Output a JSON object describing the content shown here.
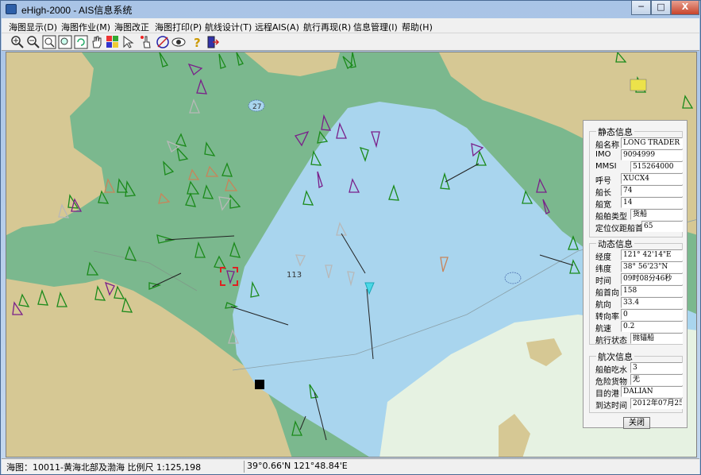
{
  "window": {
    "title": "eHigh-2000 - AIS信息系统",
    "buttons": {
      "minimize": "─",
      "maximize": "□",
      "close": "X"
    }
  },
  "menu": [
    "海图显示(D)",
    "海图作业(M)",
    "海图改正",
    "海图打印(P)",
    "航线设计(T)",
    "远程AIS(A)",
    "航行再现(R)",
    "信息管理(I)",
    "帮助(H)"
  ],
  "toolbar": {
    "tools": [
      "zoom-in-icon",
      "zoom-out-icon",
      "zoom-box-icon",
      "zoom-fit-icon",
      "refresh-icon",
      "pan-hand-icon",
      "layers-icon",
      "select-arrow-icon",
      "pick-hand-icon",
      "circle-tool-icon",
      "eye-icon",
      "help-icon",
      "exit-icon"
    ]
  },
  "map": {
    "colors": {
      "land": "#d6c894",
      "shallow": "#7bb88e",
      "water": "#a9d5ee",
      "deep": "#e6f2e2"
    },
    "labels": {
      "depth1": "27",
      "depth2": "113"
    }
  },
  "panel": {
    "static": {
      "title": "静态信息",
      "rows": [
        {
          "label": "船名称",
          "value": "LONG TRADER"
        },
        {
          "label": "IMO",
          "value": "9094999"
        },
        {
          "label": "MMSI",
          "value": "515264000"
        },
        {
          "label": "呼号",
          "value": "XUCX4"
        },
        {
          "label": "船长",
          "value": "74"
        },
        {
          "label": "船宽",
          "value": "14"
        },
        {
          "label": "船舶类型",
          "value": "货船"
        },
        {
          "label": "定位仪距船首",
          "value": "65"
        }
      ]
    },
    "dynamic": {
      "title": "动态信息",
      "rows": [
        {
          "label": "经度",
          "value": "121° 42'14\"E"
        },
        {
          "label": "纬度",
          "value": "38° 56'23\"N"
        },
        {
          "label": "时间",
          "value": "09时08分46秒"
        },
        {
          "label": "船首向",
          "value": "158"
        },
        {
          "label": "航向",
          "value": "33.4"
        },
        {
          "label": "转向率",
          "value": "0"
        },
        {
          "label": "航速",
          "value": "0.2"
        },
        {
          "label": "航行状态",
          "value": "抛锚船"
        }
      ]
    },
    "voyage": {
      "title": "航次信息",
      "rows": [
        {
          "label": "船舶吃水",
          "value": "3"
        },
        {
          "label": "危险货物",
          "value": "无"
        },
        {
          "label": "目的港",
          "value": "DALIAN"
        },
        {
          "label": "到达时间",
          "value": "2012年07月25"
        }
      ]
    },
    "close_label": "关闭"
  },
  "status": {
    "chart": "海图：10011-黄海北部及渤海  比例尺 1:125,198",
    "coords": "39°0.66'N   121°48.84'E"
  }
}
